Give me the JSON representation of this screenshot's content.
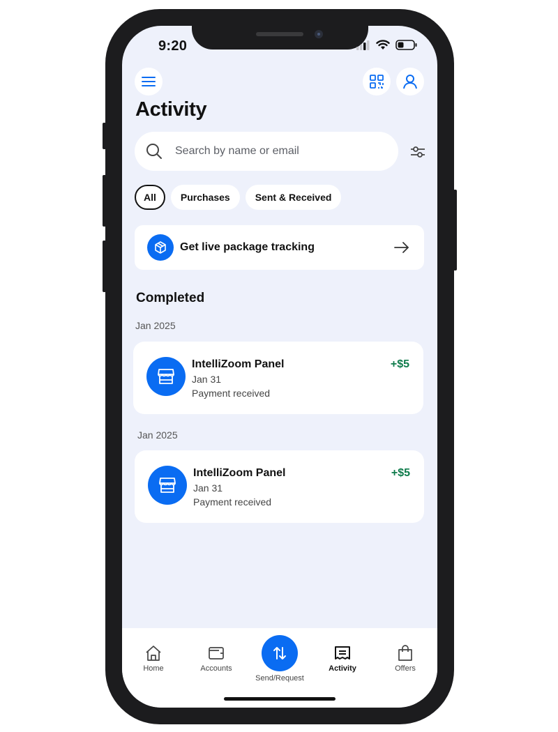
{
  "status_bar": {
    "time": "9:20"
  },
  "header": {
    "title": "Activity"
  },
  "search": {
    "placeholder": "Search by name or email"
  },
  "chips": [
    {
      "label": "All"
    },
    {
      "label": "Purchases"
    },
    {
      "label": "Sent & Received"
    }
  ],
  "tracking_card": {
    "label": "Get live package tracking"
  },
  "section": {
    "title": "Completed"
  },
  "groups": [
    {
      "date": "Jan 2025",
      "tx": {
        "name": "IntelliZoom Panel",
        "date": "Jan 31",
        "status": "Payment received",
        "amount": "+$5"
      }
    },
    {
      "date": "Jan 2025",
      "tx": {
        "name": "IntelliZoom Panel",
        "date": "Jan 31",
        "status": "Payment received",
        "amount": "+$5"
      }
    }
  ],
  "tabs": [
    {
      "label": "Home",
      "icon": "home-icon"
    },
    {
      "label": "Accounts",
      "icon": "wallet-icon"
    },
    {
      "label": "Send/Request",
      "icon": "transfer-arrows-icon"
    },
    {
      "label": "Activity",
      "icon": "receipt-icon"
    },
    {
      "label": "Offers",
      "icon": "shopping-bag-icon"
    }
  ],
  "colors": {
    "accent": "#0a6cf2",
    "positive": "#0e7b4b",
    "background": "#eef1fb"
  }
}
